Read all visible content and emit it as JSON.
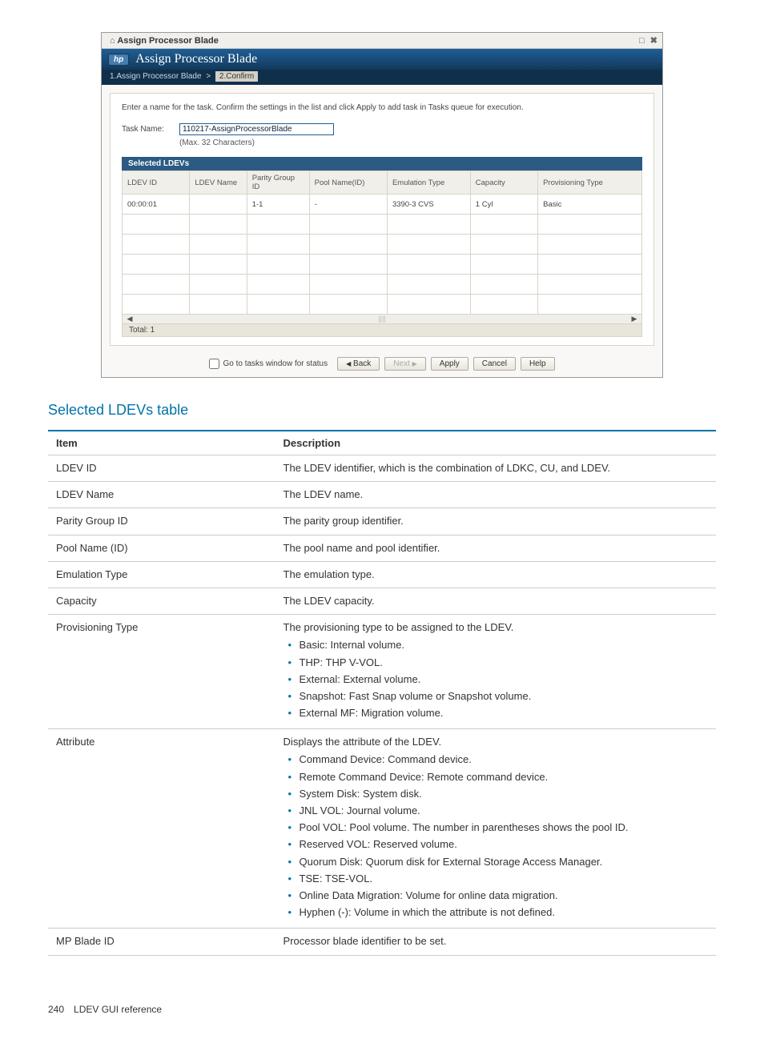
{
  "dialog": {
    "titlebar": "Assign Processor Blade",
    "hp": "hp",
    "title": "Assign Processor Blade",
    "step1": "1.Assign Processor Blade",
    "sep": ">",
    "step2": "2.Confirm",
    "instr": "Enter a name for the task. Confirm the settings in the list and click Apply to add task in Tasks queue for execution.",
    "task_label": "Task Name:",
    "task_value": "110217-AssignProcessorBlade",
    "task_note": "(Max. 32 Characters)",
    "subhead": "Selected LDEVs",
    "cols": {
      "c1": "LDEV ID",
      "c2": "LDEV Name",
      "c3": "Parity Group ID",
      "c4": "Pool Name(ID)",
      "c5": "Emulation Type",
      "c6": "Capacity",
      "c7": "Provisioning Type"
    },
    "row1": {
      "c1": "00:00:01",
      "c2": "",
      "c3": "1-1",
      "c4": "-",
      "c5": "3390-3 CVS",
      "c6": "1 Cyl",
      "c7": "Basic"
    },
    "scroll_left": "◀",
    "scroll_mid": "||||",
    "scroll_right": "▶",
    "total": "Total: 1",
    "chk_label": "Go to tasks window for status",
    "btn_back": "Back",
    "btn_next": "Next",
    "btn_apply": "Apply",
    "btn_cancel": "Cancel",
    "btn_help": "Help"
  },
  "section_title": "Selected LDEVs table",
  "ref_head": {
    "item": "Item",
    "desc": "Description"
  },
  "ref": [
    {
      "item": "LDEV ID",
      "desc": "The LDEV identifier, which is the combination of LDKC, CU, and LDEV."
    },
    {
      "item": "LDEV Name",
      "desc": "The LDEV name."
    },
    {
      "item": "Parity Group ID",
      "desc": "The parity group identifier."
    },
    {
      "item": "Pool Name (ID)",
      "desc": "The pool name and pool identifier."
    },
    {
      "item": "Emulation Type",
      "desc": "The emulation type."
    },
    {
      "item": "Capacity",
      "desc": "The LDEV capacity."
    },
    {
      "item": "Provisioning Type",
      "desc": "The provisioning type to be assigned to the LDEV.",
      "bullets": [
        "Basic: Internal volume.",
        "THP: THP V-VOL.",
        "External: External volume.",
        "Snapshot: Fast Snap volume or Snapshot volume.",
        "External MF: Migration volume."
      ]
    },
    {
      "item": "Attribute",
      "desc": "Displays the attribute of the LDEV.",
      "bullets": [
        "Command Device: Command device.",
        "Remote Command Device: Remote command device.",
        "System Disk: System disk.",
        "JNL VOL: Journal volume.",
        "Pool VOL: Pool volume. The number in parentheses shows the pool ID.",
        "Reserved VOL: Reserved volume.",
        "Quorum Disk: Quorum disk for External Storage Access Manager.",
        "TSE: TSE-VOL.",
        "Online Data Migration: Volume for online data migration.",
        "Hyphen (-): Volume in which the attribute is not defined."
      ]
    },
    {
      "item": "MP Blade ID",
      "desc": "Processor blade identifier to be set."
    }
  ],
  "footer": "240 LDEV GUI reference"
}
